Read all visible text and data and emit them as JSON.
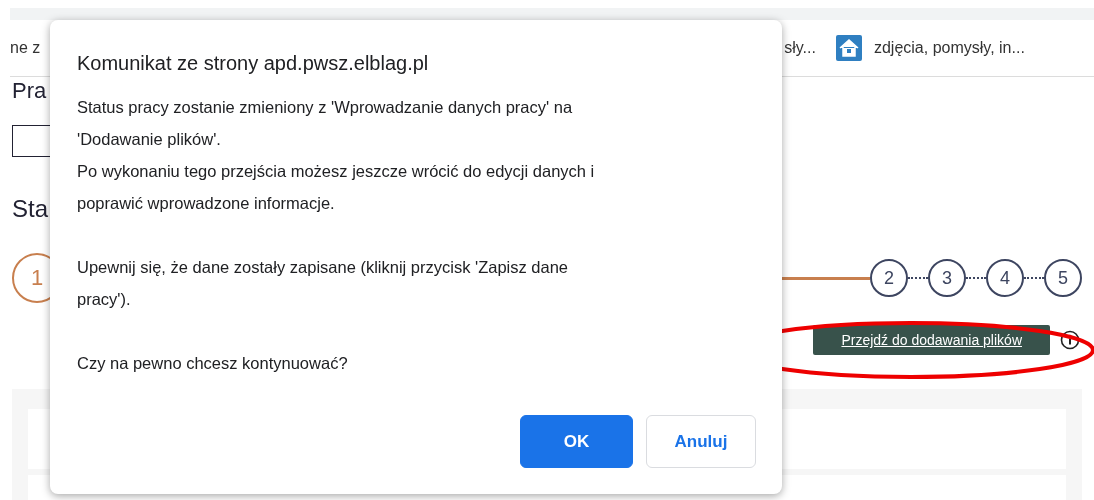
{
  "bookmarks": [
    {
      "label": "ne z"
    },
    {
      "label": "sły..."
    },
    {
      "label": "zdjęcia, pomysły, in..."
    }
  ],
  "page": {
    "heading": "Pra",
    "section_title": "Sta",
    "steps": [
      {
        "label": "1",
        "selected": true
      },
      {
        "label": "2",
        "selected": false
      },
      {
        "label": "3",
        "selected": false
      },
      {
        "label": "4",
        "selected": false
      },
      {
        "label": "5",
        "selected": false
      }
    ],
    "next_button": "Przejdź do dodawania plików"
  },
  "dialog": {
    "title": "Komunikat ze strony apd.pwsz.elblag.pl",
    "paragraphs": [
      [
        "Status pracy zostanie zmieniony z 'Wprowadzanie danych pracy' na",
        "'Dodawanie plików'.",
        "Po wykonaniu tego przejścia możesz jeszcze wrócić do edycji danych i",
        "poprawić wprowadzone informacje."
      ],
      [
        "Upewnij się, że dane zostały zapisane (kliknij przycisk 'Zapisz dane",
        "pracy')."
      ],
      [
        "Czy na pewno chcesz kontynuować?"
      ]
    ],
    "buttons": [
      {
        "label": "OK",
        "kind": "primary"
      },
      {
        "label": "Anuluj",
        "kind": "secondary"
      }
    ]
  }
}
